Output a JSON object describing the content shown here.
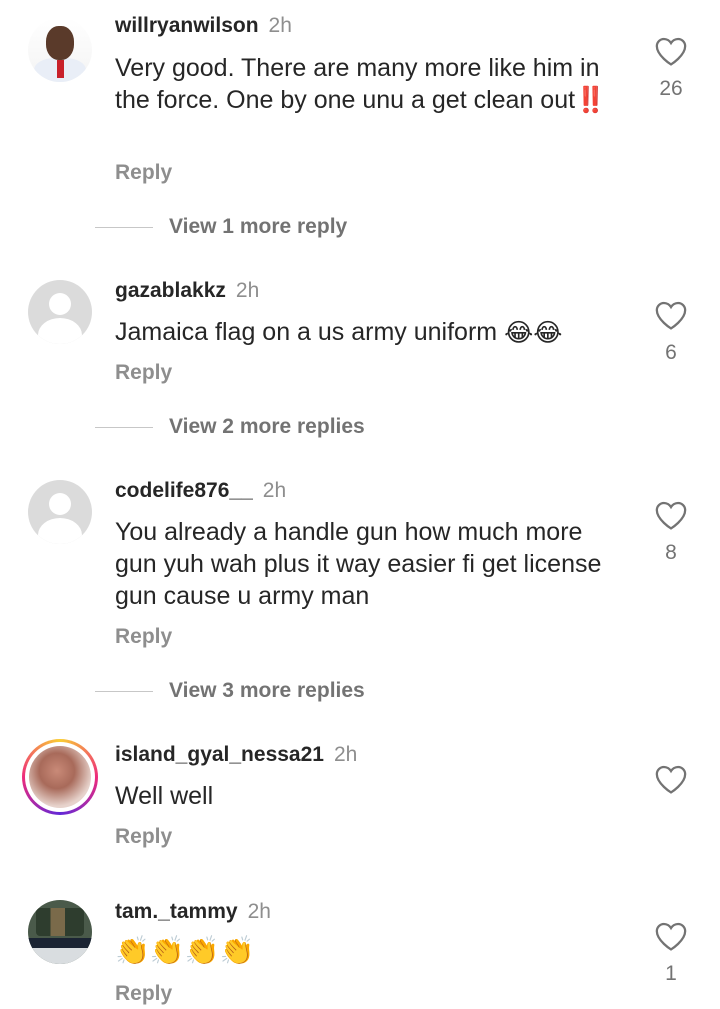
{
  "comments": [
    {
      "username": "willryanwilson",
      "time": "2h",
      "text": "Very good. There are many more like him in the force. One by one unu a get clean out",
      "text_emoji": "‼️",
      "reply_label": "Reply",
      "likes": "26",
      "view_replies": "View 1 more reply"
    },
    {
      "username": "gazablakkz",
      "time": "2h",
      "text": "Jamaica flag on a us army uniform",
      "text_emoji": "😂😂",
      "reply_label": "Reply",
      "likes": "6",
      "view_replies": "View 2 more replies"
    },
    {
      "username": "codelife876__",
      "time": "2h",
      "text": "You already a handle gun how much more gun yuh wah plus it way easier fi get license gun cause u army man",
      "reply_label": "Reply",
      "likes": "8",
      "view_replies": "View 3 more replies"
    },
    {
      "username": "island_gyal_nessa21",
      "time": "2h",
      "text": "Well well",
      "reply_label": "Reply",
      "likes": ""
    },
    {
      "username": "tam._tammy",
      "time": "2h",
      "text_emoji": "👏👏👏👏",
      "reply_label": "Reply",
      "likes": "1"
    }
  ],
  "icons": {
    "like": "heart-outline-icon",
    "default_avatar": "default-avatar-icon"
  },
  "colors": {
    "text": "#262626",
    "secondary": "#8e8e8e",
    "divider": "#c7c7c7"
  }
}
